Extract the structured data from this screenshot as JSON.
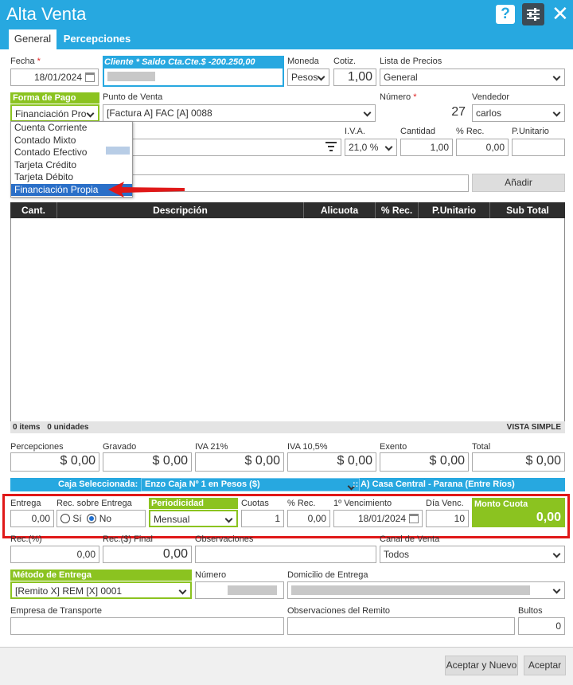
{
  "window": {
    "title": "Alta Venta",
    "help": "?",
    "close": "✕"
  },
  "tabs": [
    "General",
    "Percepciones"
  ],
  "header": {
    "fecha_label": "Fecha",
    "req_mark": "*",
    "fecha_value": "18/01/2024",
    "cliente_label": "Cliente",
    "saldo_label": "Saldo Cta.Cte.$ -200.250,00",
    "moneda_label": "Moneda",
    "moneda_value": "Pesos",
    "cotiz_label": "Cotiz.",
    "cotiz_value": "1,00",
    "lista_label": "Lista de Precios",
    "lista_value": "General",
    "forma_pago_label": "Forma de Pago",
    "forma_pago_value": "Financiación Pro",
    "punto_venta_label": "Punto de Venta",
    "punto_venta_value": "[Factura A] FAC [A] 0088",
    "numero_label": "Número",
    "numero_value": "27",
    "vendedor_label": "Vendedor",
    "vendedor_value": "carlos"
  },
  "forma_pago_options": [
    "Cuenta Corriente",
    "Contado Mixto",
    "Contado Efectivo",
    "Tarjeta Crédito",
    "Tarjeta Débito",
    "Financiación Propia"
  ],
  "item_entry": {
    "iva_label": "I.V.A.",
    "iva_value": "21,0 %",
    "cantidad_label": "Cantidad",
    "cantidad_value": "1,00",
    "rec_label": "% Rec.",
    "rec_value": "0,00",
    "punitario_label": "P.Unitario",
    "add_button": "Añadir"
  },
  "grid": {
    "columns": [
      "Cant.",
      "Descripción",
      "Alicuota",
      "% Rec.",
      "P.Unitario",
      "Sub Total"
    ],
    "footer_items": "0 items",
    "footer_units": "0 unidades",
    "view_label": "VISTA SIMPLE"
  },
  "totals": [
    {
      "label": "Percepciones",
      "value": "$ 0,00"
    },
    {
      "label": "Gravado",
      "value": "$ 0,00"
    },
    {
      "label": "IVA 21%",
      "value": "$ 0,00"
    },
    {
      "label": "IVA 10,5%",
      "value": "$ 0,00"
    },
    {
      "label": "Exento",
      "value": "$ 0,00"
    },
    {
      "label": "Total",
      "value": "$ 0,00"
    }
  ],
  "caja": {
    "label": "Caja Seleccionada:",
    "value": "Enzo Caja Nº 1 en Pesos ($)",
    "sucursal": ":: A) Casa Central - Parana (Entre Ríos)"
  },
  "financiacion": {
    "entrega_label": "Entrega",
    "entrega_value": "0,00",
    "rec_entrega_label": "Rec. sobre Entrega",
    "si_label": "Sí",
    "no_label": "No",
    "periodicidad_label": "Periodicidad",
    "periodicidad_value": "Mensual",
    "cuotas_label": "Cuotas",
    "cuotas_value": "1",
    "rec_label": "% Rec.",
    "rec_value": "0,00",
    "venc_label": "1º Vencimiento",
    "venc_value": "18/01/2024",
    "dia_label": "Día Venc.",
    "dia_value": "10",
    "monto_label": "Monto Cuota",
    "monto_value": "0,00"
  },
  "extra": {
    "rec_pct_label": "Rec.(%)",
    "rec_pct_value": "0,00",
    "rec_final_label": "Rec.($) Final",
    "rec_final_value": "0,00",
    "obs_label": "Observaciones",
    "canal_label": "Canal de Venta",
    "canal_value": "Todos"
  },
  "entrega": {
    "metodo_label": "Método de Entrega",
    "metodo_value": "[Remito X] REM [X] 0001",
    "numero_label": "Número",
    "domicilio_label": "Domicilio de Entrega",
    "transporte_label": "Empresa de Transporte",
    "obs_remito_label": "Observaciones del Remito",
    "bultos_label": "Bultos",
    "bultos_value": "0"
  },
  "buttons": {
    "accept_new": "Aceptar y Nuevo",
    "accept": "Aceptar"
  },
  "colors": {
    "title_bar": "#27a8e0",
    "green": "#8bc320",
    "red_frame": "#e01818",
    "selection": "#2a6fc8"
  }
}
